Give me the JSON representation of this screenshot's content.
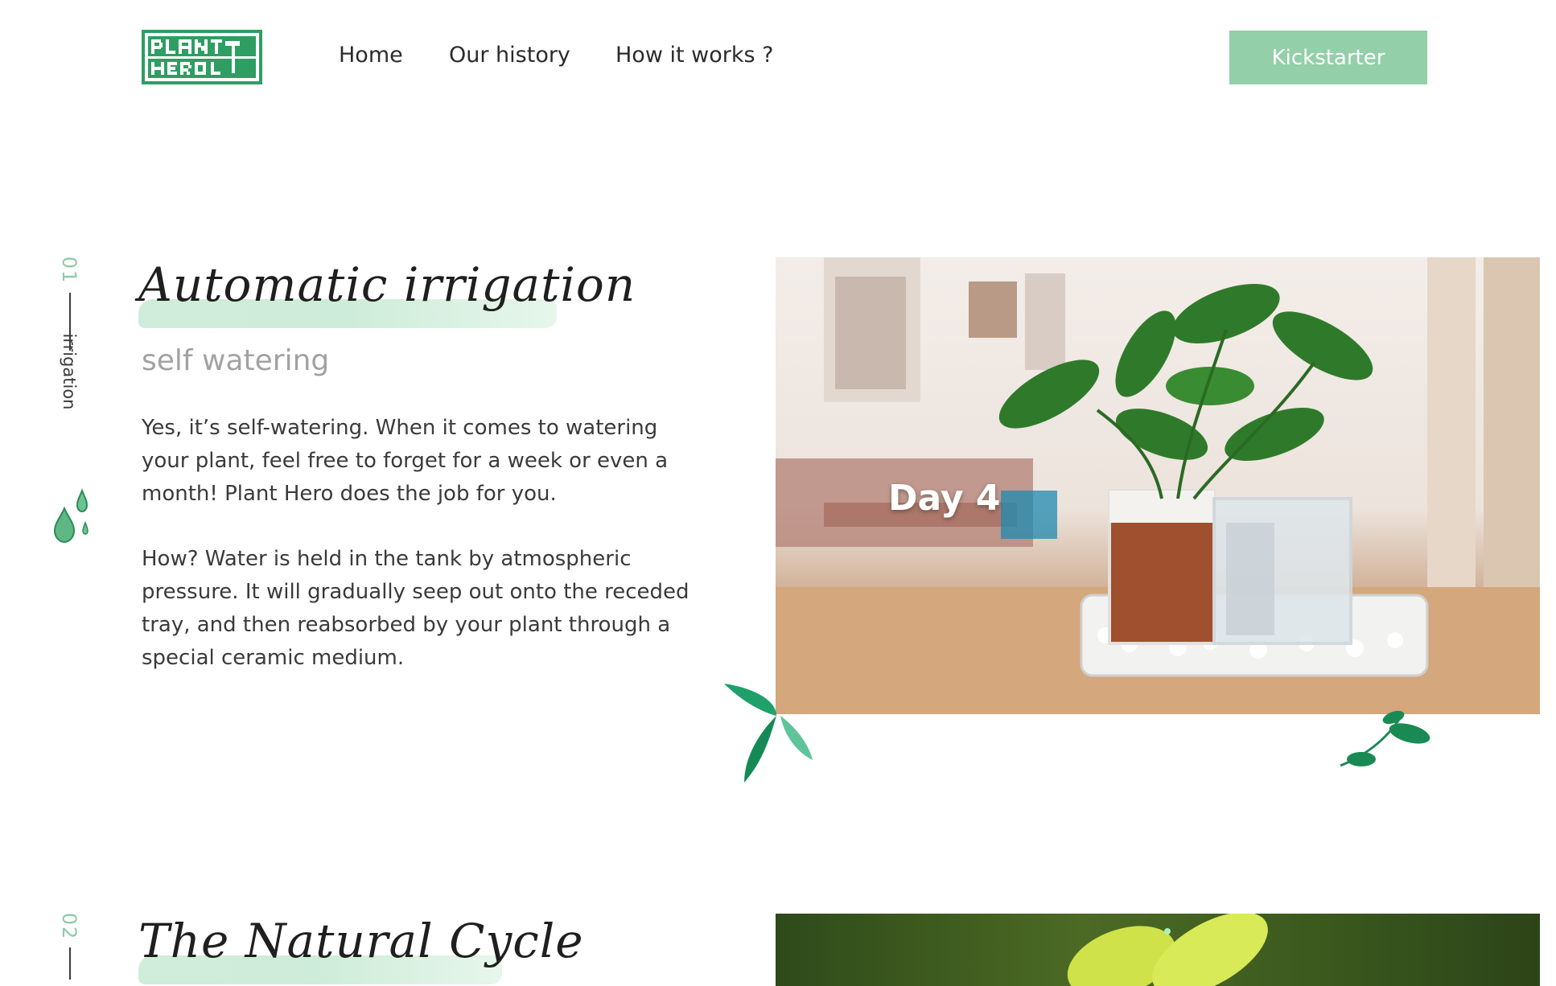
{
  "header": {
    "logo_alt": "Plant Hero",
    "nav": [
      {
        "label": "Home"
      },
      {
        "label": "Our history"
      },
      {
        "label": "How it works ?"
      }
    ],
    "cta_label": "Kickstarter"
  },
  "sections": [
    {
      "number": "01",
      "rail_label": "irrigation",
      "title": "Automatic irrigation",
      "subtitle": "self watering",
      "paragraphs": [
        "Yes, it’s self-watering. When it comes to watering your plant, feel free to forget for a week or even a month! Plant Hero does the job for you.",
        "How? Water is held in the tank by atmospheric pressure. It will gradually seep out onto the receded tray, and then reabsorbed by your plant through a special ceramic medium."
      ],
      "image_caption": "Day 4"
    },
    {
      "number": "02",
      "title": "The Natural Cycle"
    }
  ],
  "colors": {
    "accent": "#93cfa8",
    "logo_green": "#2e9e62",
    "text": "#3a3a3a",
    "muted": "#a2a2a2"
  }
}
